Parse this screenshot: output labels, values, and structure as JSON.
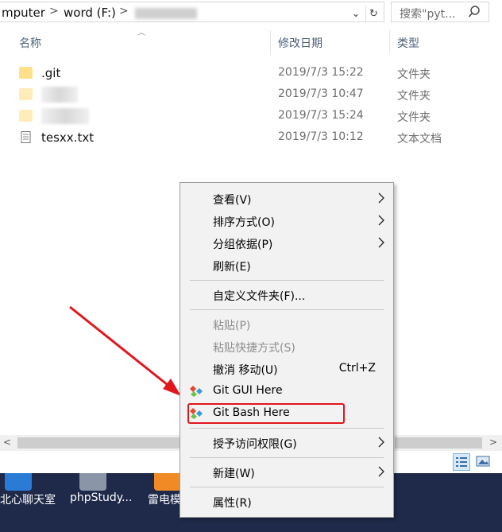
{
  "address_bar": {
    "crumb_computer": "mputer",
    "separator": ">",
    "crumb_drive": "word (F:)",
    "dropdown_glyph": "⌄",
    "refresh_glyph": "↻"
  },
  "search": {
    "placeholder": "搜索\"pyt..."
  },
  "columns": {
    "name": "名称",
    "modified": "修改日期",
    "type": "类型"
  },
  "files": [
    {
      "name": ".git",
      "modified": "2019/7/3 15:22",
      "type": "文件夹",
      "icon": "folder-icon"
    },
    {
      "name": "",
      "modified": "2019/7/3 10:47",
      "type": "文件夹",
      "icon": "folder-icon"
    },
    {
      "name": "",
      "modified": "2019/7/3 15:24",
      "type": "文件夹",
      "icon": "folder-icon"
    },
    {
      "name": "tesxx.txt",
      "modified": "2019/7/3 10:12",
      "type": "文本文档",
      "icon": "text-file-icon"
    }
  ],
  "context_menu": {
    "view": "查看(V)",
    "sort_by": "排序方式(O)",
    "group_by": "分组依据(P)",
    "refresh": "刷新(E)",
    "customize_folder": "自定义文件夹(F)...",
    "paste": "粘贴(P)",
    "paste_shortcut": "粘贴快捷方式(S)",
    "undo_move": "撤消 移动(U)",
    "undo_shortcut": "Ctrl+Z",
    "git_gui": "Git GUI Here",
    "git_bash": "Git Bash Here",
    "give_access": "授予访问权限(G)",
    "new": "新建(W)",
    "properties": "属性(R)"
  },
  "taskbar": {
    "items": [
      "北心聊天室",
      "phpStudy...",
      "雷电模"
    ]
  },
  "colors": {
    "highlight_red": "#e2161d",
    "folder_yellow": "#ffe08a",
    "taskbar_bg": "#1f2a4a"
  }
}
